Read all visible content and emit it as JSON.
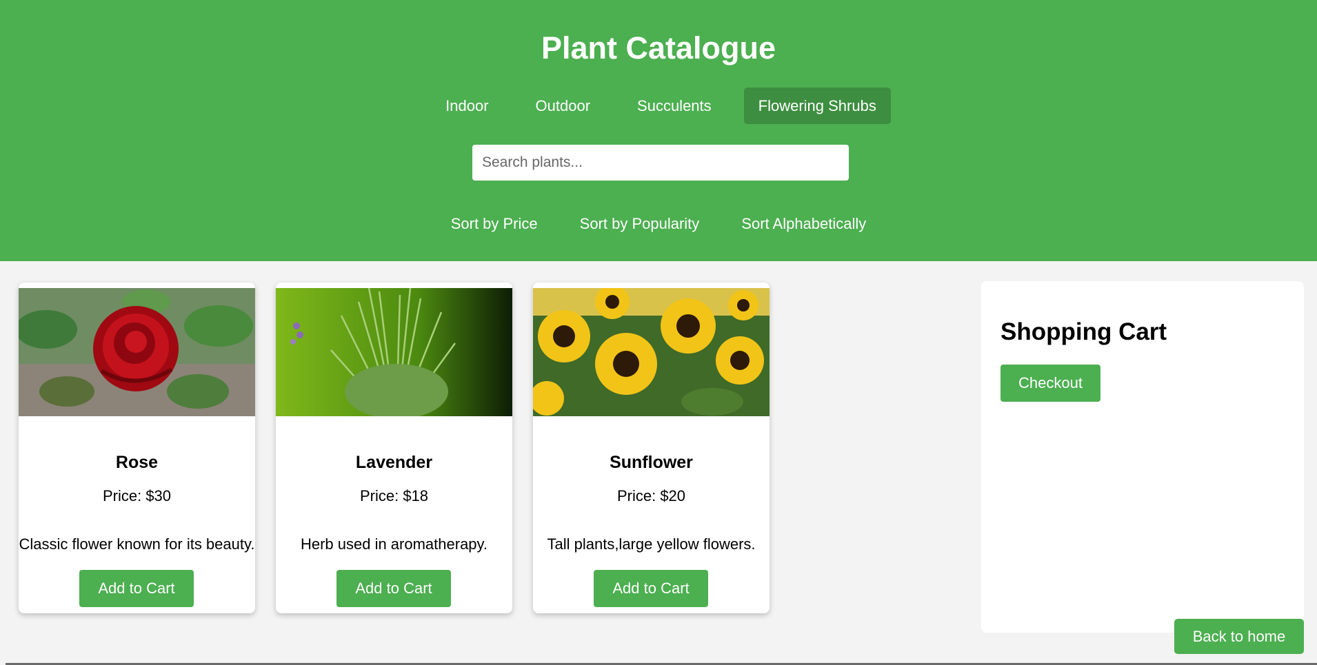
{
  "header": {
    "title": "Plant Catalogue",
    "categories": [
      {
        "label": "Indoor",
        "active": false
      },
      {
        "label": "Outdoor",
        "active": false
      },
      {
        "label": "Succulents",
        "active": false
      },
      {
        "label": "Flowering Shrubs",
        "active": true
      }
    ],
    "search": {
      "placeholder": "Search plants...",
      "value": ""
    },
    "sort_options": [
      "Sort by Price",
      "Sort by Popularity",
      "Sort Alphabetically"
    ]
  },
  "products": [
    {
      "name": "Rose",
      "price": "Price: $30",
      "description": "Classic flower known for its beauty.",
      "button": "Add to Cart"
    },
    {
      "name": "Lavender",
      "price": "Price: $18",
      "description": "Herb used in aromatherapy.",
      "button": "Add to Cart"
    },
    {
      "name": "Sunflower",
      "price": "Price: $20",
      "description": "Tall plants,large yellow flowers.",
      "button": "Add to Cart"
    }
  ],
  "cart": {
    "title": "Shopping Cart",
    "checkout_label": "Checkout"
  },
  "footer": {
    "back_home_label": "Back to home"
  },
  "colors": {
    "primary": "#4caf50",
    "active_tab": "#3d8e40",
    "background": "#f3f3f3"
  }
}
